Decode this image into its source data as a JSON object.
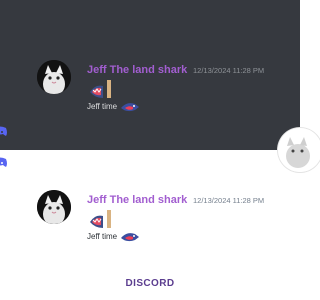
{
  "messages": [
    {
      "theme": "dark",
      "username": "Jeff The land shark",
      "timestamp": "12/13/2024 11:28 PM",
      "text": "Jeff time",
      "avatar_icon": "cat-avatar-icon",
      "emoji_icon": "shark-mouth-emoji-icon",
      "inline_emoji_icon": "shark-emoji-icon"
    },
    {
      "theme": "light",
      "username": "Jeff The land shark",
      "timestamp": "12/13/2024 11:28 PM",
      "text": "Jeff time",
      "avatar_icon": "cat-avatar-icon",
      "emoji_icon": "shark-mouth-emoji-icon",
      "inline_emoji_icon": "shark-emoji-icon"
    }
  ],
  "footer": {
    "brand_label": "DISCORD"
  },
  "colors": {
    "dark_bg": "#36393f",
    "light_bg": "#ffffff",
    "username": "#a25ed0",
    "discord_blurple": "#5865f2",
    "brand": "#5b3d8f"
  },
  "icons": {
    "left_top": "discord-logo-icon",
    "left_bottom": "discord-logo-icon",
    "right_avatar": "cat-avatar-icon"
  }
}
